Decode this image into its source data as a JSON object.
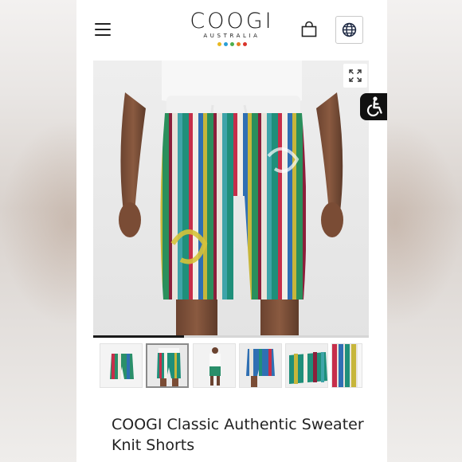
{
  "brand": {
    "wordmark": "COOGI",
    "subtitle": "AUSTRALIA",
    "dot_colors": [
      "#e8b820",
      "#2a9fd6",
      "#4cae4c",
      "#e67e22",
      "#d9342b"
    ]
  },
  "header": {
    "menu_icon": "hamburger-menu-icon",
    "bag_icon": "shopping-bag-icon",
    "locale_icon": "globe-icon"
  },
  "gallery": {
    "expand_icon": "expand-arrows-icon",
    "progress_fraction": 0.33,
    "thumbnail_count": 6,
    "active_thumbnail_index": 1
  },
  "product": {
    "title": "COOGI Classic Authentic Sweater Knit Shorts"
  },
  "accessibility": {
    "icon": "wheelchair-accessibility-icon",
    "color": "#111111"
  }
}
